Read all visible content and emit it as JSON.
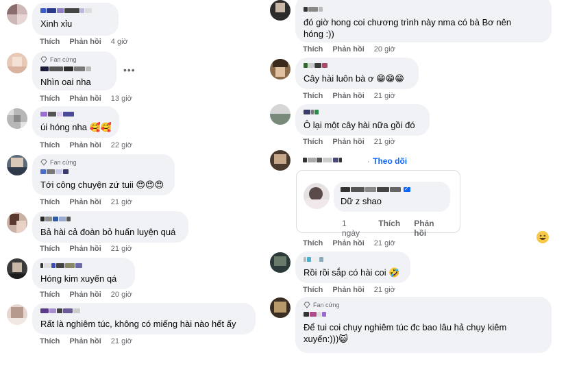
{
  "labels": {
    "like": "Thích",
    "reply": "Phản hồi",
    "fan_badge": "Fan cứng",
    "follow": "Theo dõi"
  },
  "colors": {
    "bubble": "#f0f2f5",
    "meta_gray": "#65676b",
    "link_blue": "#0866ff"
  },
  "left_comments": [
    {
      "id": "c1",
      "text": "Xinh xỉu",
      "time": "4 giờ",
      "fan": false
    },
    {
      "id": "c2",
      "text": "Nhìn oai nha",
      "time": "13 giờ",
      "fan": true
    },
    {
      "id": "c3",
      "text": "úi hóng nha 🥰🥰",
      "time": "22 giờ",
      "fan": false
    },
    {
      "id": "c4",
      "text": "Tới công chuyện zứ tuii 😍😍😍",
      "time": "21 giờ",
      "fan": true
    },
    {
      "id": "c5",
      "text": "Bả hài cả đoàn bỏ huấn luyện quá",
      "time": "21 giờ",
      "fan": false
    },
    {
      "id": "c6",
      "text": "Hóng kim xuyến qá",
      "time": "20 giờ",
      "fan": false
    },
    {
      "id": "c7",
      "text": "Rất là nghiêm túc, không có miếng hài nào hết ấy",
      "time": "21 giờ",
      "fan": false
    }
  ],
  "right_comments": [
    {
      "id": "r1",
      "line1": "đó giờ hong coi chương trình này nma có bà Bơ nên",
      "line2": "hóng :))",
      "time": "20 giờ"
    },
    {
      "id": "r2",
      "text": "Cây hài luôn bà ơ 😁😁😁",
      "time": "21 giờ"
    },
    {
      "id": "r3",
      "text": "Ô lại một cây hài nữa gồi đó",
      "time": "21 giờ"
    },
    {
      "id": "r4",
      "shared_text": "Dữ z shao",
      "shared_time": "1 ngày",
      "time": "21 giờ"
    },
    {
      "id": "r5",
      "text": "Rồi rồi sắp có hài coi 🤣",
      "time": "21 giờ"
    },
    {
      "id": "r6",
      "line1": "Để tui coi chụy nghiêm túc đc bao lâu hả chụy kiêm",
      "line2": "xuyến:)))😺",
      "fan": true
    }
  ]
}
